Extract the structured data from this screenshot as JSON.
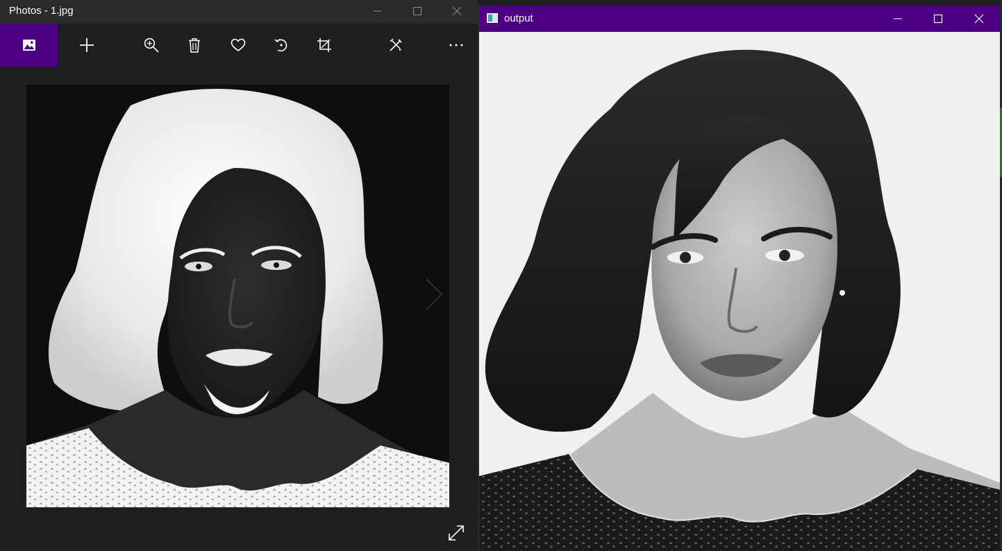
{
  "photos_window": {
    "title": "Photos - 1.jpg",
    "caption_buttons": [
      "minimize-icon",
      "maximize-icon",
      "close-icon"
    ],
    "toolbar": [
      {
        "name": "view-collection-button",
        "icon": "photo-icon",
        "active": true
      },
      {
        "name": "add-to-button",
        "icon": "plus-icon"
      },
      {
        "name": "zoom-button",
        "icon": "zoom-in-icon"
      },
      {
        "name": "delete-button",
        "icon": "trash-icon"
      },
      {
        "name": "favorite-button",
        "icon": "heart-icon"
      },
      {
        "name": "rotate-button",
        "icon": "rotate-icon"
      },
      {
        "name": "crop-button",
        "icon": "crop-icon"
      },
      {
        "name": "edit-button",
        "icon": "edit-tools-icon"
      },
      {
        "name": "more-options-button",
        "icon": "more-icon"
      }
    ],
    "image_description_note": "inverted negative black-and-white portrait",
    "accent_color": "#4d0082"
  },
  "output_window": {
    "title": "output",
    "caption_buttons": [
      "minimize-icon",
      "maximize-icon",
      "close-icon"
    ],
    "titlebar_color": "#4d0082"
  }
}
